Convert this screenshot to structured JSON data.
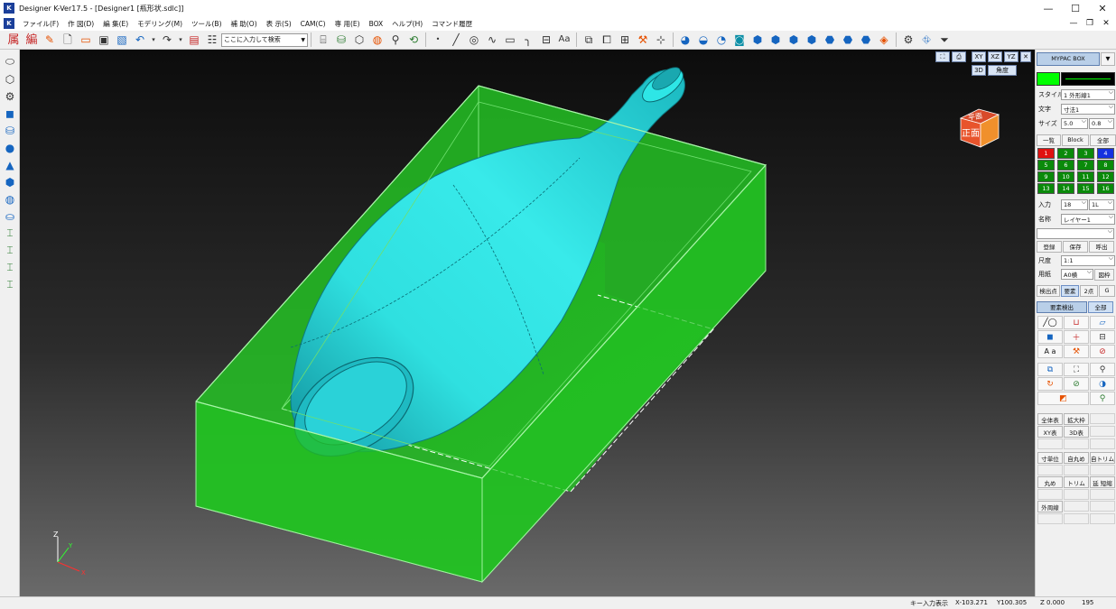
{
  "window": {
    "title": "Designer K-Ver17.5 - [Designer1 [瓶形状.sdlc]]",
    "logo": "K",
    "controls": [
      "—",
      "☐",
      "✕"
    ],
    "mdi_controls": [
      "—",
      "❐",
      "✕"
    ]
  },
  "menu": {
    "logo": "K",
    "items": [
      "ファイル(F)",
      "作 図(D)",
      "編 集(E)",
      "モデリング(M)",
      "ツール(B)",
      "補 助(O)",
      "表 示(S)",
      "CAM(C)",
      "専 用(E)",
      "BOX",
      "ヘルプ(H)",
      "コマンド履歴"
    ]
  },
  "toolbar": {
    "text_buttons": [
      "属",
      "編"
    ],
    "search": {
      "placeholder": "ここに入力して検索"
    },
    "text_tool": "Aa"
  },
  "viewport": {
    "view_buttons": [
      "XY",
      "XZ",
      "YZ",
      "3D",
      "角度"
    ],
    "view_cube": {
      "top": "平面",
      "front": "正面"
    },
    "axis": {
      "z": "Z",
      "y": "Y",
      "x": "X"
    },
    "colors": {
      "box_fill": "#2fd42f",
      "box_edge": "#9ff29f",
      "bottle_fill": "#2fe0e0",
      "bottle_dark": "#128a94",
      "background_top": "#0c0c0c",
      "background_bottom": "#6a6a6a"
    }
  },
  "right_panel": {
    "mypac": "MYPAC BOX",
    "style_label": "スタイル",
    "style_value": "1 外形線1",
    "text_label": "文字",
    "text_value": "寸法1",
    "size_label": "サイズ",
    "size_value1": "5.0",
    "size_value2": "0.8",
    "tabs": [
      "一覧",
      "Block",
      "全部"
    ],
    "layers": [
      "1",
      "2",
      "3",
      "4",
      "5",
      "6",
      "7",
      "8",
      "9",
      "10",
      "11",
      "12",
      "13",
      "14",
      "15",
      "16"
    ],
    "layer_colors": [
      "#e01010",
      "#0a8a0a",
      "#0a8a0a",
      "#1530e0",
      "#0a8a0a",
      "#0a8a0a",
      "#0a8a0a",
      "#0a8a0a",
      "#0a8a0a",
      "#0a8a0a",
      "#0a8a0a",
      "#0a8a0a",
      "#0a8a0a",
      "#0a8a0a",
      "#0a8a0a",
      "#0a8a0a"
    ],
    "input_label": "入力",
    "input_value1": "18",
    "input_value2": "1L",
    "name_label": "名称",
    "name_value": "レイヤー1",
    "reg_buttons": [
      "登録",
      "保存",
      "呼出"
    ],
    "scale_label": "尺度",
    "scale_value": "1:1",
    "paper_label": "用紙",
    "paper_value": "A0横",
    "frame_button": "図枠",
    "detect_buttons": [
      "検出点",
      "要素",
      "2点",
      "G"
    ],
    "elem_detect": "要素検出",
    "all_button": "全部",
    "text_aa": "A a",
    "view_buttons": [
      "全体表",
      "拡大枠",
      "XY表",
      "3D表"
    ],
    "edit_buttons": [
      "寸単位",
      "自丸め",
      "自トリム",
      "丸め",
      "トリム",
      "延 短縮",
      "外周線"
    ]
  },
  "status": {
    "key_input": "キー入力表示",
    "x": "X-103.271",
    "y": "Y100.305",
    "z": "Z 0.000",
    "num": "195"
  }
}
